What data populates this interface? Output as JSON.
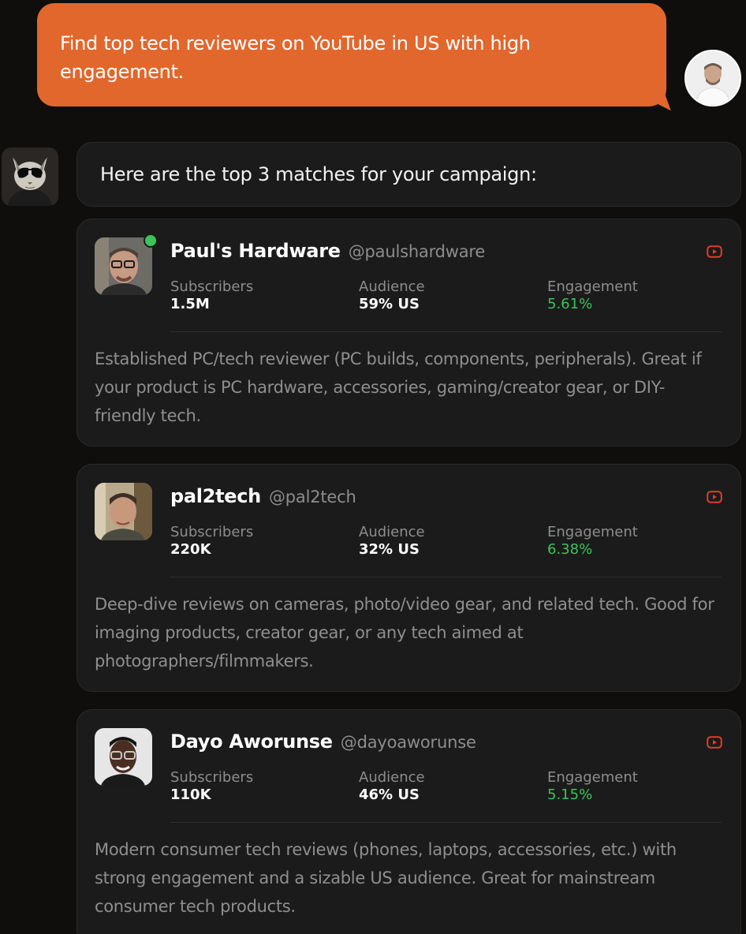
{
  "user_message": {
    "text": "Find top tech reviewers on YouTube in US with high engagement."
  },
  "assistant_message": {
    "text": "Here are the top 3 matches for your campaign:"
  },
  "colors": {
    "accent": "#e2672c",
    "engagement_green": "#3cc35a",
    "youtube_red": "#e23c2c",
    "card_bg": "#1b1b1b",
    "page_bg": "#0f0e0d"
  },
  "creators": [
    {
      "name": "Paul's Hardware",
      "handle": "@paulshardware",
      "platform_icon": "youtube-icon",
      "online": true,
      "stats": {
        "subscribers_label": "Subscribers",
        "subscribers": "1.5M",
        "audience_label": "Audience",
        "audience": "59% US",
        "engagement_label": "Engagement",
        "engagement": "5.61%"
      },
      "description": "Established PC/tech reviewer (PC builds, components, peripherals). Great if your product is PC hardware, accessories, gaming/creator gear, or DIY-friendly tech."
    },
    {
      "name": "pal2tech",
      "handle": "@pal2tech",
      "platform_icon": "youtube-icon",
      "online": false,
      "stats": {
        "subscribers_label": "Subscribers",
        "subscribers": "220K",
        "audience_label": "Audience",
        "audience": "32% US",
        "engagement_label": "Engagement",
        "engagement": "6.38%"
      },
      "description": "Deep-dive reviews on cameras, photo/video gear, and related tech. Good for imaging products, creator gear, or any tech aimed at photographers/filmmakers."
    },
    {
      "name": "Dayo Aworunse",
      "handle": "@dayoaworunse",
      "platform_icon": "youtube-icon",
      "online": false,
      "stats": {
        "subscribers_label": "Subscribers",
        "subscribers": "110K",
        "audience_label": "Audience",
        "audience": "46% US",
        "engagement_label": "Engagement",
        "engagement": "5.15%"
      },
      "description": "Modern consumer tech reviews (phones, laptops, accessories, etc.) with strong engagement and a sizable US audience. Great for mainstream consumer tech products."
    }
  ]
}
